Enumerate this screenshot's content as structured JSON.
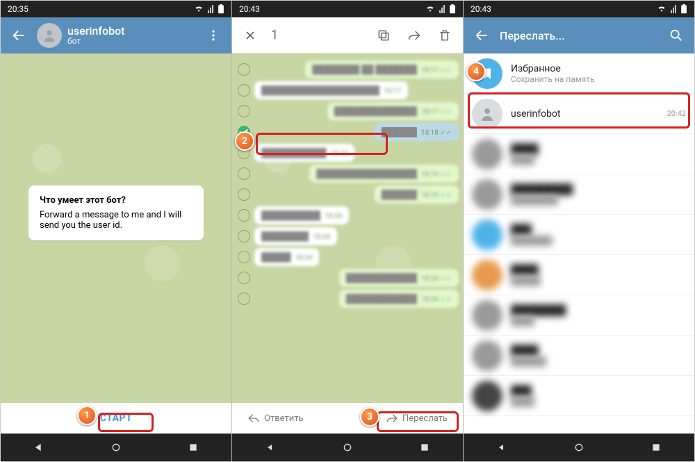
{
  "pane1": {
    "status_time": "20:35",
    "header": {
      "title": "userinfobot",
      "subtitle": "бот"
    },
    "card": {
      "question": "Что умеет этот бот?",
      "desc": "Forward a message to me and I will send you the user id."
    },
    "start_label": "СТАРТ"
  },
  "pane2": {
    "status_time": "20:43",
    "selected_count": "1",
    "messages": [
      {
        "dir": "out",
        "time": "18:17",
        "selected": false,
        "text": "████████ ██ ███████"
      },
      {
        "dir": "in",
        "time": "18:17",
        "selected": false,
        "text": "████████████████████"
      },
      {
        "dir": "out",
        "time": "18:17",
        "selected": false,
        "text": "██████████████"
      },
      {
        "dir": "out",
        "time": "18:18",
        "selected": true,
        "text": "██████"
      },
      {
        "dir": "in",
        "time": "18:18",
        "selected": false,
        "text": "███████████"
      },
      {
        "dir": "out",
        "time": "18:19",
        "selected": false,
        "text": "█████████████████"
      },
      {
        "dir": "out",
        "time": "18:19",
        "selected": false,
        "text": "██████"
      },
      {
        "dir": "in",
        "time": "18:34",
        "selected": false,
        "text": "██████████"
      },
      {
        "dir": "in",
        "time": "18:34",
        "selected": false,
        "text": "████████"
      },
      {
        "dir": "in",
        "time": "18:34",
        "selected": false,
        "text": "█████"
      },
      {
        "dir": "out",
        "time": "18:34",
        "selected": false,
        "text": "████████████"
      },
      {
        "dir": "out",
        "time": "18:34",
        "selected": false,
        "text": "████████████"
      }
    ],
    "reply_label": "Ответить",
    "forward_label": "Переслать"
  },
  "pane3": {
    "status_time": "20:43",
    "header_title": "Переслать...",
    "items": [
      {
        "kind": "bookmark",
        "name": "Избранное",
        "sub": "Сохранить на память",
        "time": ""
      },
      {
        "kind": "grey",
        "name": "userinfobot",
        "sub": "",
        "time": "20:42"
      },
      {
        "kind": "blur",
        "name": "████",
        "sub": "████",
        "time": ""
      },
      {
        "kind": "blur",
        "name": "█████████",
        "sub": "████████",
        "time": ""
      },
      {
        "kind": "blur-blue",
        "name": "███",
        "sub": "███████",
        "time": ""
      },
      {
        "kind": "blur-orange",
        "name": "████",
        "sub": "█████",
        "time": ""
      },
      {
        "kind": "blur",
        "name": "████████",
        "sub": "████",
        "time": ""
      },
      {
        "kind": "blur",
        "name": "████",
        "sub": "██████",
        "time": ""
      },
      {
        "kind": "blur-dark",
        "name": "███",
        "sub": "████",
        "time": ""
      }
    ]
  },
  "callouts": {
    "c1": "1",
    "c2": "2",
    "c3": "3",
    "c4": "4"
  }
}
